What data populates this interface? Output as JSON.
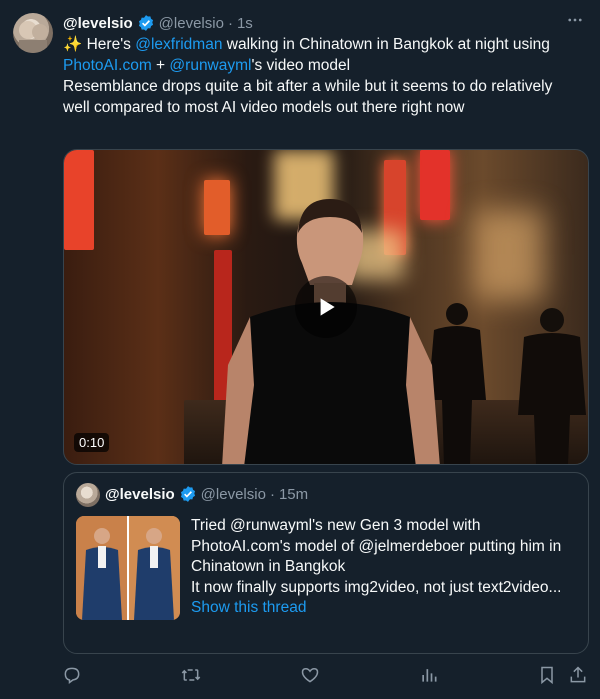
{
  "colors": {
    "background": "#15202b",
    "link": "#1d9bf0",
    "muted": "#8b98a5",
    "border": "#38444d",
    "verified": "#1d9bf0"
  },
  "tweet": {
    "display_name": "@levelsio",
    "handle": "@levelsio",
    "separator": "·",
    "time": "1s",
    "more_icon": "more-horizontal-icon",
    "text": {
      "l1_pre": "✨ Here's ",
      "l1_mention": "@lexfridman",
      "l1_post": " walking in Chinatown in Bangkok at night using",
      "l2_link": "PhotoAI.com",
      "l2_mid": " + ",
      "l2_mention": "@runwayml",
      "l2_post": "'s video model",
      "p2_l1": "Resemblance drops quite a bit after a while but it seems to do relatively",
      "p2_l2": "well compared to most AI video models out there right now"
    },
    "media": {
      "duration": "0:10",
      "play_icon": "play-icon"
    }
  },
  "quoted": {
    "display_name": "@levelsio",
    "handle": "@levelsio",
    "separator": "·",
    "time": "15m",
    "lines": [
      "Tried @runwayml's new Gen 3 model with",
      "PhotoAI.com's model of @jelmerdeboer putting him in",
      "Chinatown in Bangkok",
      "It now finally supports img2video, not just text2video..."
    ],
    "show_thread": "Show this thread"
  },
  "actions": [
    "reply-icon",
    "retweet-icon",
    "like-icon",
    "analytics-icon",
    "bookmark-icon",
    "share-icon"
  ]
}
